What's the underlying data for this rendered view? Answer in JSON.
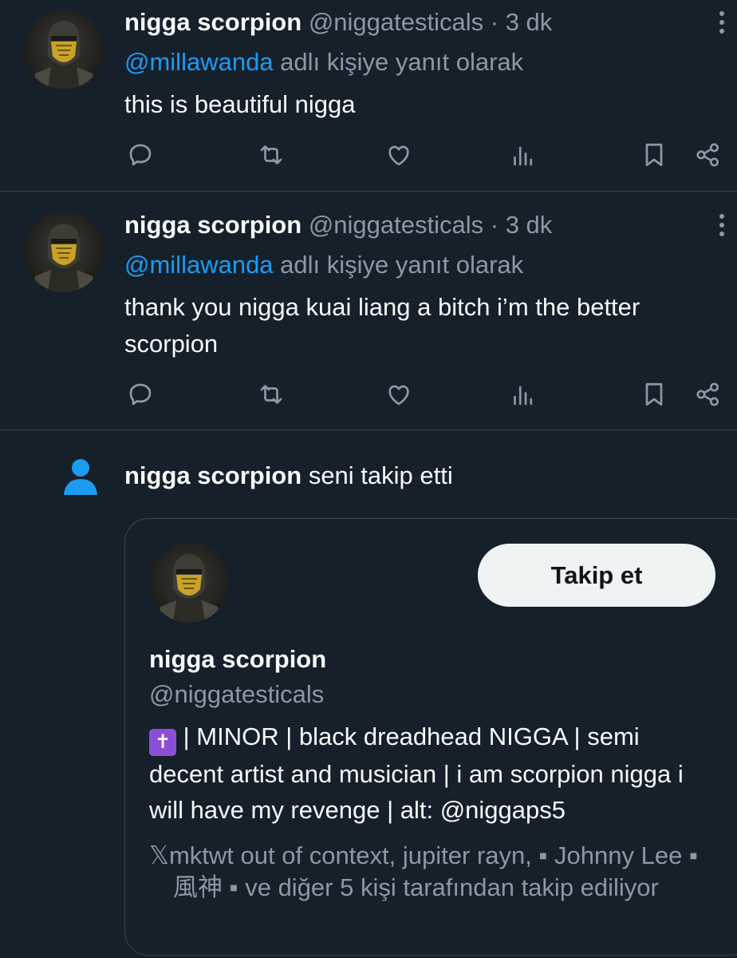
{
  "tweets": [
    {
      "name": "nigga scorpion",
      "handle": "@niggatesticals",
      "separator": "·",
      "time": "3 dk",
      "reply_mention": "@millawanda",
      "reply_suffix": "adlı kişiye yanıt olarak",
      "text": "this is beautiful nigga"
    },
    {
      "name": "nigga scorpion",
      "handle": "@niggatesticals",
      "separator": "·",
      "time": "3 dk",
      "reply_mention": "@millawanda",
      "reply_suffix": "adlı kişiye yanıt olarak",
      "text": "thank you nigga kuai liang a bitch i’m the better scorpion"
    }
  ],
  "actions": [
    "reply-icon",
    "retweet-icon",
    "like-icon",
    "views-icon",
    "bookmark-icon",
    "share-icon"
  ],
  "follow_notification": {
    "name": "nigga scorpion",
    "action_text": "seni takip etti",
    "icon": "person-icon",
    "icon_color": "#1d9bf0"
  },
  "profile_card": {
    "follow_button_label": "Takip et",
    "name": "nigga scorpion",
    "handle": "@niggatesticals",
    "bio_badge": "✝",
    "bio_text": "| MINOR | black dreadhead NIGGA | semi decent artist and musician | i am scorpion nigga i will have my revenge | alt: @niggaps5",
    "followed_by_text": "𝕏mktwt out of context, jupiter rayn, ▪ Johnny Lee ▪ 風神 ▪ ve diğer 5 kişi tarafından takip ediliyor"
  },
  "colors": {
    "background": "#15202b",
    "text": "#f7f9f9",
    "secondary_text": "#8b98a5",
    "accent": "#1d9bf0",
    "border": "#38444d"
  }
}
